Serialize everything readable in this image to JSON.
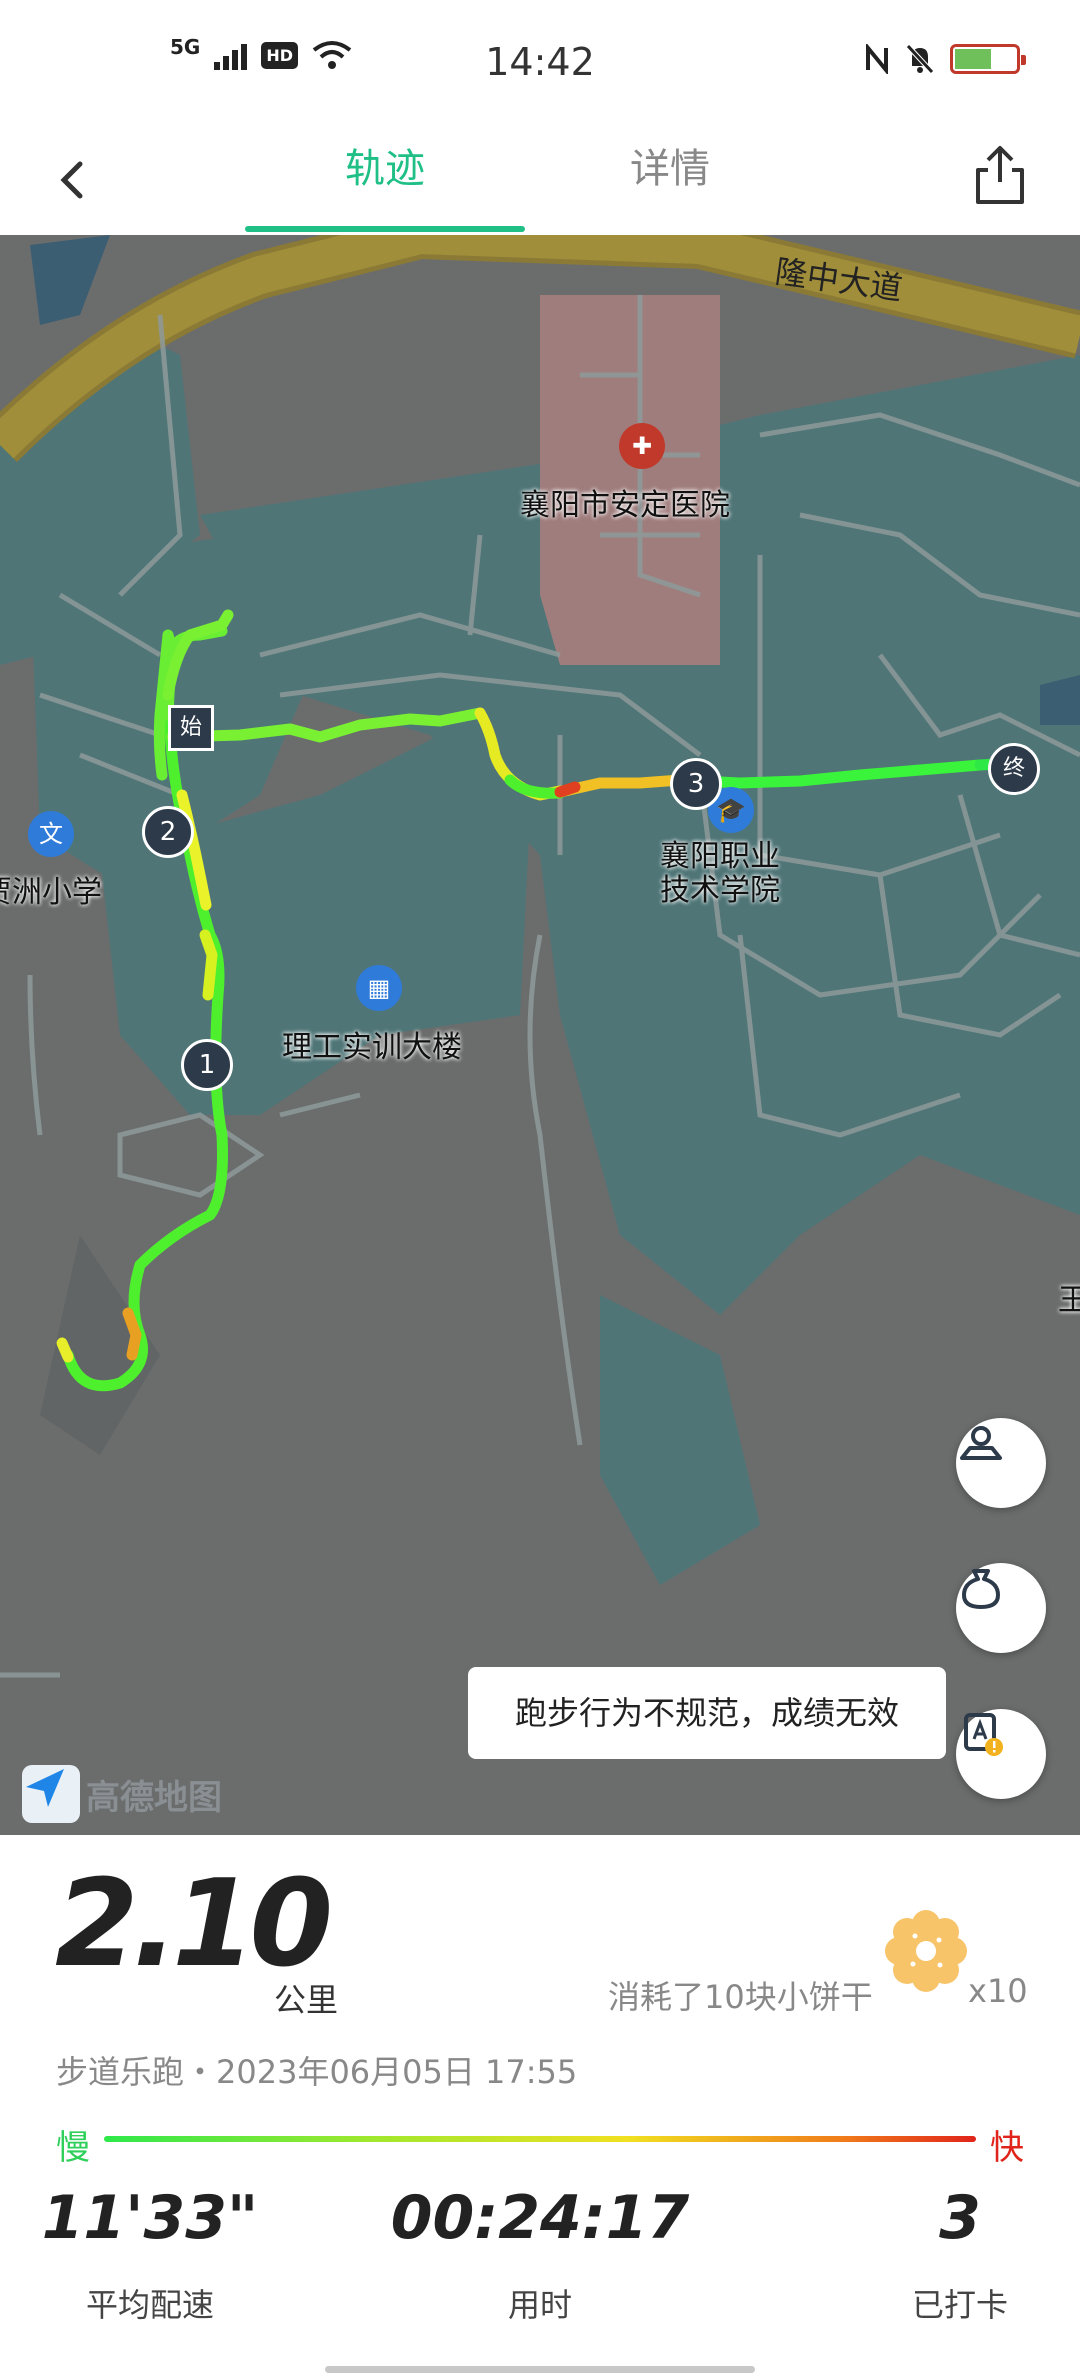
{
  "status_bar": {
    "network": "5G",
    "hd": "HD",
    "time": "14:42",
    "battery_level": 0.6
  },
  "nav": {
    "tabs": [
      {
        "label": "轨迹",
        "active": true
      },
      {
        "label": "详情",
        "active": false
      }
    ],
    "accent": "#1fbf86"
  },
  "map": {
    "road_label": "隆中大道",
    "pois": [
      {
        "name": "襄阳市安定医院",
        "icon": "hospital-icon"
      },
      {
        "name": "贾洲小学",
        "icon": "culture-icon"
      },
      {
        "name": "理工实训大楼",
        "icon": "building-icon"
      },
      {
        "name": "襄阳职业\n技术学院",
        "icon": "school-icon"
      }
    ],
    "edge_label": "王",
    "markers": {
      "start": "始",
      "end": "终",
      "checkpoints": [
        "1",
        "2",
        "3"
      ]
    },
    "toast": "跑步行为不规范，成绩无效",
    "logo_text": "高德地图"
  },
  "summary": {
    "distance": "2.10",
    "distance_unit": "公里",
    "calories_text": "消耗了10块小饼干",
    "cookie_multiplier": "x10",
    "subtitle": "步道乐跑・2023年06月05日 17:55",
    "speed_slow": "慢",
    "speed_fast": "快",
    "stats": [
      {
        "value": "11'33\"",
        "label": "平均配速"
      },
      {
        "value": "00:24:17",
        "label": "用时"
      },
      {
        "value": "3",
        "label": "已打卡"
      }
    ]
  }
}
